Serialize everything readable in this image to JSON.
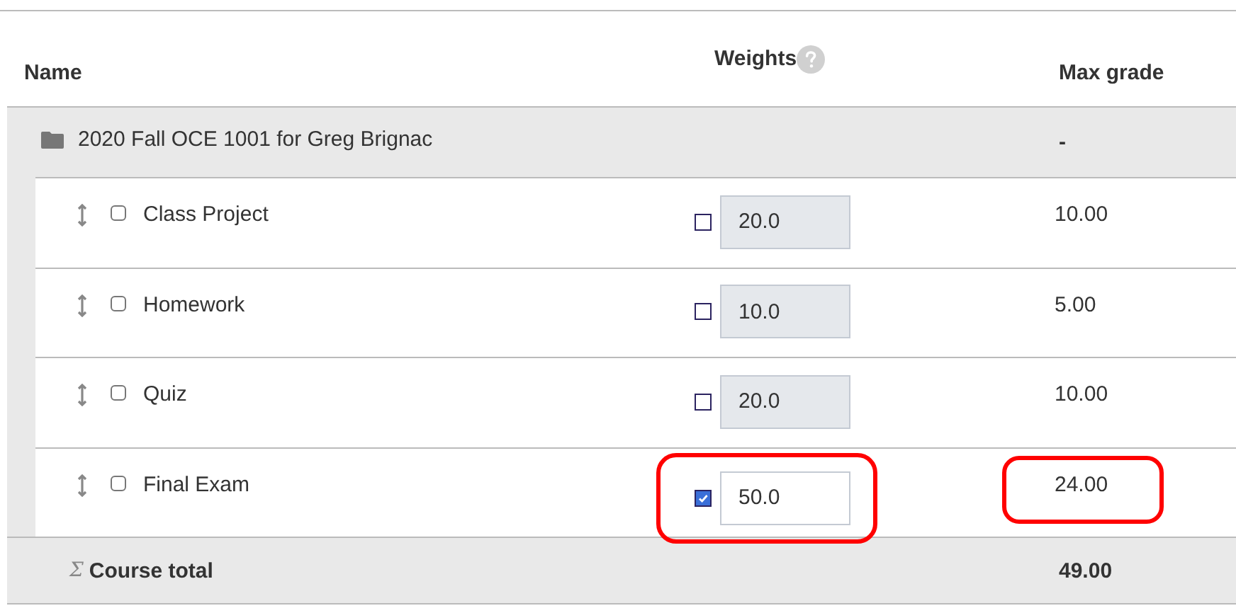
{
  "table": {
    "columns": [
      {
        "label": "Name"
      },
      {
        "label": "Weights",
        "help_icon": true
      },
      {
        "label": "Max grade"
      }
    ],
    "category": {
      "name": "2020 Fall OCE 1001 for Greg Brignac",
      "max_grade": "-"
    },
    "items": [
      {
        "name": "Class Project",
        "selected": false,
        "weight_override": false,
        "weight": "20.0",
        "max_grade": "10.00",
        "highlighted": false
      },
      {
        "name": "Homework",
        "selected": false,
        "weight_override": false,
        "weight": "10.0",
        "max_grade": "5.00",
        "highlighted": false
      },
      {
        "name": "Quiz",
        "selected": false,
        "weight_override": false,
        "weight": "20.0",
        "max_grade": "10.00",
        "highlighted": false
      },
      {
        "name": "Final Exam",
        "selected": false,
        "weight_override": true,
        "weight": "50.0",
        "max_grade": "24.00",
        "highlighted": true
      }
    ],
    "total": {
      "symbol": "Σ",
      "label": "Course total",
      "max_grade": "49.00"
    }
  }
}
